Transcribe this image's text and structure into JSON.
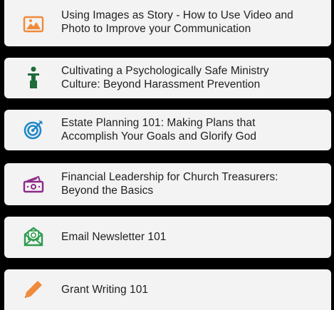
{
  "courses": [
    {
      "icon": "image-icon",
      "title_lines": [
        "Using Images as Story - How to Use Video and",
        "Photo to Improve your Communication"
      ]
    },
    {
      "icon": "person-icon",
      "title_lines": [
        "Cultivating a Psychologically Safe Ministry",
        "Culture: Beyond Harassment Prevention"
      ]
    },
    {
      "icon": "target-icon",
      "title_lines": [
        "Estate Planning 101: Making Plans that",
        "Accomplish Your Goals and Glorify God"
      ]
    },
    {
      "icon": "money-icon",
      "title_lines": [
        "Financial Leadership for Church Treasurers:",
        "Beyond the Basics"
      ]
    },
    {
      "icon": "email-icon",
      "title_lines": [
        "Email Newsletter 101"
      ]
    },
    {
      "icon": "pencil-icon",
      "title_lines": [
        "Grant Writing 101"
      ]
    }
  ],
  "colors": {
    "background": "#000000",
    "card": "#f3f3f3",
    "text": "#1f1f1f",
    "image_icon": "#f08a3c",
    "person_icon": "#1f6b3a",
    "target_icon": "#1e88c8",
    "money_icon": "#8e2a8a",
    "email_icon": "#2e9b4e",
    "pencil_icon": "#f08a3c"
  }
}
